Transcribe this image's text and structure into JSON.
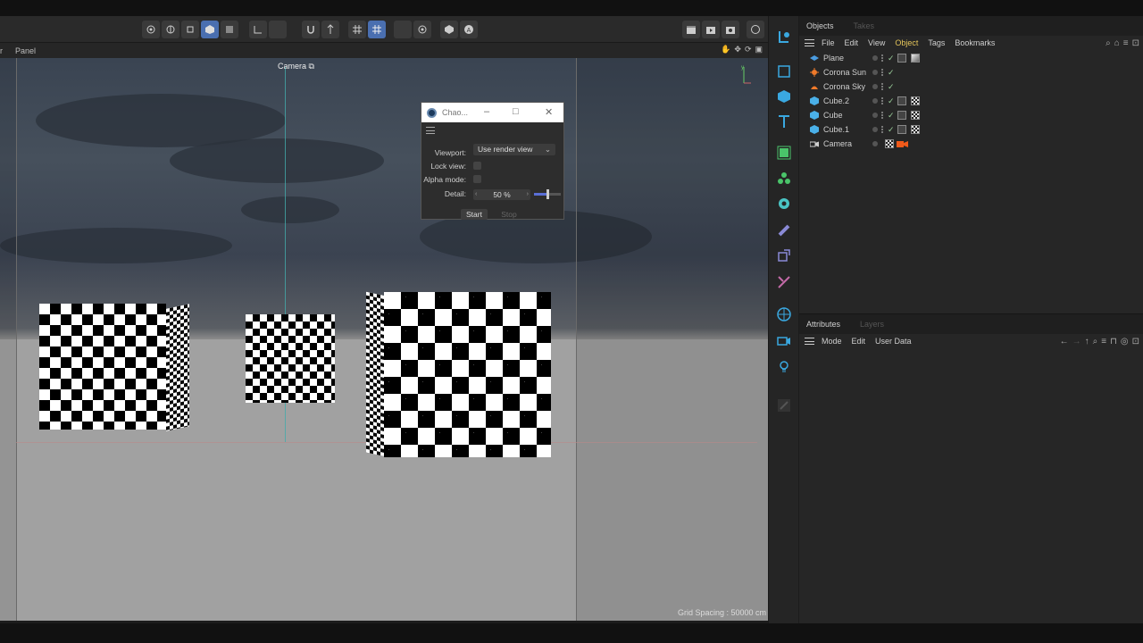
{
  "viewport_menu": {
    "panel_label": "Panel",
    "first_label": "r"
  },
  "viewport": {
    "camera_label": "Camera",
    "grid_spacing": "Grid Spacing : 50000 cm"
  },
  "chaos_window": {
    "title": "Chao...",
    "viewport_label": "Viewport:",
    "viewport_value": "Use render view",
    "lock_view_label": "Lock view:",
    "alpha_mode_label": "Alpha mode:",
    "detail_label": "Detail:",
    "detail_value": "50 %",
    "detail_fraction": 0.5,
    "start_label": "Start",
    "stop_label": "Stop"
  },
  "objects_panel": {
    "tabs": [
      {
        "label": "Objects"
      },
      {
        "label": "Takes"
      }
    ],
    "menu": [
      {
        "label": "File"
      },
      {
        "label": "Edit"
      },
      {
        "label": "View"
      },
      {
        "label": "Object"
      },
      {
        "label": "Tags"
      },
      {
        "label": "Bookmarks"
      }
    ],
    "objects": [
      {
        "name": "Plane",
        "icon": "plane-icon",
        "color": "#4a9be0"
      },
      {
        "name": "Corona Sun",
        "icon": "sun-icon",
        "color": "#f07a2a"
      },
      {
        "name": "Corona Sky",
        "icon": "sky-icon",
        "color": "#f07a2a"
      },
      {
        "name": "Cube.2",
        "icon": "cube-icon",
        "color": "#4ab0e8"
      },
      {
        "name": "Cube",
        "icon": "cube-icon",
        "color": "#4ab0e8"
      },
      {
        "name": "Cube.1",
        "icon": "cube-icon",
        "color": "#4ab0e8"
      },
      {
        "name": "Camera",
        "icon": "camera-icon",
        "color": "#cfcfcf"
      }
    ]
  },
  "attributes_panel": {
    "tabs": [
      {
        "label": "Attributes"
      },
      {
        "label": "Layers"
      }
    ],
    "menu": [
      {
        "label": "Mode"
      },
      {
        "label": "Edit"
      },
      {
        "label": "User Data"
      }
    ]
  },
  "colors": {
    "accent": "#4a6fb0",
    "highlight_menu": "#e3c45a",
    "slider_fill": "#5a6fd6"
  }
}
